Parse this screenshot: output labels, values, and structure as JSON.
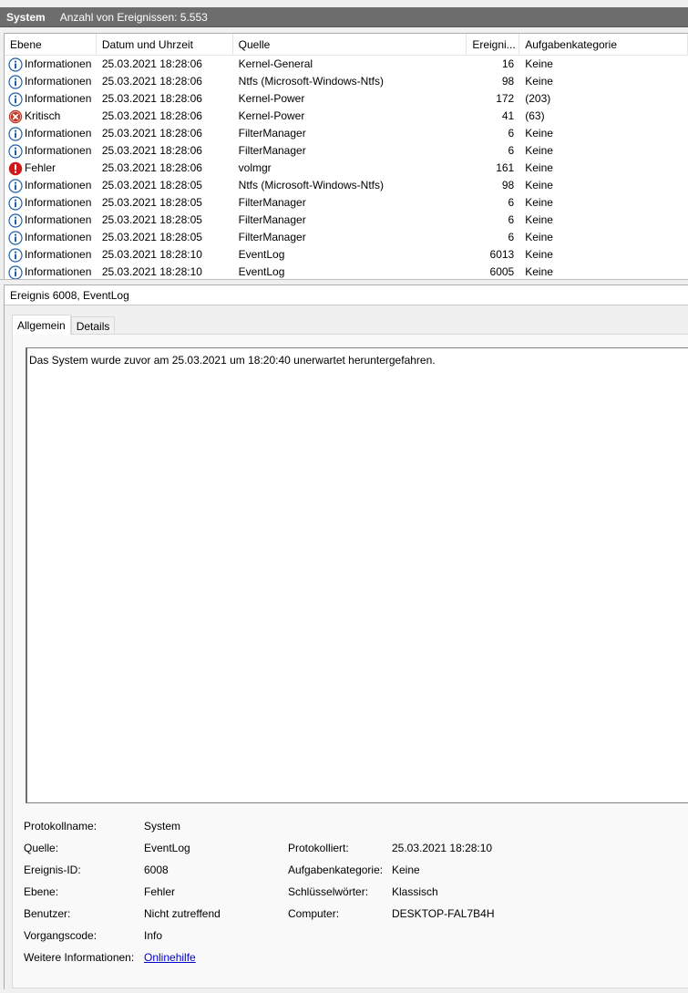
{
  "log_bar": {
    "name": "System",
    "count_text": "Anzahl von Ereignissen: 5.553"
  },
  "columns": [
    "Ebene",
    "Datum und Uhrzeit",
    "Quelle",
    "Ereigni...",
    "Aufgabenkategorie"
  ],
  "events": [
    {
      "icon": "info-icon",
      "level": "Informationen",
      "datetime": "25.03.2021 18:28:06",
      "source": "Kernel-General",
      "id": "16",
      "category": "Keine"
    },
    {
      "icon": "info-icon",
      "level": "Informationen",
      "datetime": "25.03.2021 18:28:06",
      "source": "Ntfs (Microsoft-Windows-Ntfs)",
      "id": "98",
      "category": "Keine"
    },
    {
      "icon": "info-icon",
      "level": "Informationen",
      "datetime": "25.03.2021 18:28:06",
      "source": "Kernel-Power",
      "id": "172",
      "category": "(203)"
    },
    {
      "icon": "critical-icon",
      "level": "Kritisch",
      "datetime": "25.03.2021 18:28:06",
      "source": "Kernel-Power",
      "id": "41",
      "category": "(63)"
    },
    {
      "icon": "info-icon",
      "level": "Informationen",
      "datetime": "25.03.2021 18:28:06",
      "source": "FilterManager",
      "id": "6",
      "category": "Keine"
    },
    {
      "icon": "info-icon",
      "level": "Informationen",
      "datetime": "25.03.2021 18:28:06",
      "source": "FilterManager",
      "id": "6",
      "category": "Keine"
    },
    {
      "icon": "error-icon",
      "level": "Fehler",
      "datetime": "25.03.2021 18:28:06",
      "source": "volmgr",
      "id": "161",
      "category": "Keine"
    },
    {
      "icon": "info-icon",
      "level": "Informationen",
      "datetime": "25.03.2021 18:28:05",
      "source": "Ntfs (Microsoft-Windows-Ntfs)",
      "id": "98",
      "category": "Keine"
    },
    {
      "icon": "info-icon",
      "level": "Informationen",
      "datetime": "25.03.2021 18:28:05",
      "source": "FilterManager",
      "id": "6",
      "category": "Keine"
    },
    {
      "icon": "info-icon",
      "level": "Informationen",
      "datetime": "25.03.2021 18:28:05",
      "source": "FilterManager",
      "id": "6",
      "category": "Keine"
    },
    {
      "icon": "info-icon",
      "level": "Informationen",
      "datetime": "25.03.2021 18:28:05",
      "source": "FilterManager",
      "id": "6",
      "category": "Keine"
    },
    {
      "icon": "info-icon",
      "level": "Informationen",
      "datetime": "25.03.2021 18:28:10",
      "source": "EventLog",
      "id": "6013",
      "category": "Keine"
    },
    {
      "icon": "info-icon",
      "level": "Informationen",
      "datetime": "25.03.2021 18:28:10",
      "source": "EventLog",
      "id": "6005",
      "category": "Keine"
    }
  ],
  "detail": {
    "title": "Ereignis 6008, EventLog",
    "tabs": [
      "Allgemein",
      "Details"
    ],
    "description": "Das System wurde zuvor am 25.03.2021 um 18:20:40 unerwartet heruntergefahren.",
    "labels": {
      "log_name": "Protokollname:",
      "source": "Quelle:",
      "event_id": "Ereignis-ID:",
      "level": "Ebene:",
      "user": "Benutzer:",
      "opcode": "Vorgangscode:",
      "more_info": "Weitere Informationen:",
      "logged": "Protokolliert:",
      "task_category": "Aufgabenkategorie:",
      "keywords": "Schlüsselwörter:",
      "computer": "Computer:"
    },
    "values": {
      "log_name": "System",
      "source": "EventLog",
      "event_id": "6008",
      "level": "Fehler",
      "user": "Nicht zutreffend",
      "opcode": "Info",
      "more_info_link": "Onlinehilfe",
      "logged": "25.03.2021 18:28:10",
      "task_category": "Keine",
      "keywords": "Klassisch",
      "computer": "DESKTOP-FAL7B4H"
    }
  },
  "colors": {
    "header_bar": "#6d6d6d",
    "info_icon": "#1f5fa8",
    "critical_icon": "#c0392b",
    "error_icon": "#d01818",
    "link": "#0000cc"
  }
}
